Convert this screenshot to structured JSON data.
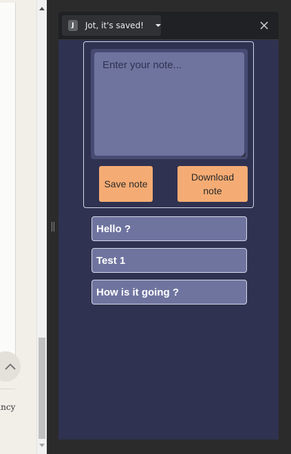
{
  "background_page": {
    "partial_text": "ancy"
  },
  "side_panel": {
    "extension_badge": "J",
    "extension_name": "Jot, it's saved!",
    "close_icon": "close-icon",
    "editor": {
      "value": "",
      "placeholder": "Enter your note..."
    },
    "buttons": {
      "save_label": "Save note",
      "download_line1": "Download",
      "download_line2": "note"
    },
    "notes": [
      {
        "title": "Hello ?"
      },
      {
        "title": "Test 1"
      },
      {
        "title": "How is it going ?"
      }
    ]
  },
  "colors": {
    "panel_bg": "#2f3250",
    "note_bg": "#6f749f",
    "button_bg": "#f5ac74",
    "header_bg": "#202124"
  }
}
